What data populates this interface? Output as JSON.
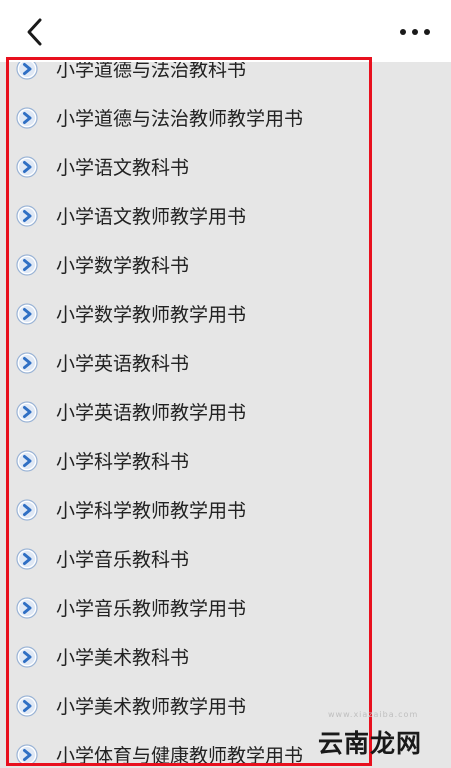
{
  "header": {
    "back_icon": "chevron-left-icon",
    "more_icon": "more-horizontal-icon"
  },
  "colors": {
    "accent_icon": "#2f6fc4",
    "highlight_border": "#e8101e",
    "background": "#e6e6e6"
  },
  "list": {
    "item_icon": "play-circle-icon",
    "items": [
      {
        "label": "小学道德与法治教科书"
      },
      {
        "label": "小学道德与法治教师教学用书"
      },
      {
        "label": "小学语文教科书"
      },
      {
        "label": "小学语文教师教学用书"
      },
      {
        "label": "小学数学教科书"
      },
      {
        "label": "小学数学教师教学用书"
      },
      {
        "label": "小学英语教科书"
      },
      {
        "label": "小学英语教师教学用书"
      },
      {
        "label": "小学科学教科书"
      },
      {
        "label": "小学科学教师教学用书"
      },
      {
        "label": "小学音乐教科书"
      },
      {
        "label": "小学音乐教师教学用书"
      },
      {
        "label": "小学美术教科书"
      },
      {
        "label": "小学美术教师教学用书"
      },
      {
        "label": "小学体育与健康教师教学用书"
      }
    ]
  },
  "watermark": {
    "text": "云南龙网",
    "sub": "www.xiazaiba.com"
  }
}
